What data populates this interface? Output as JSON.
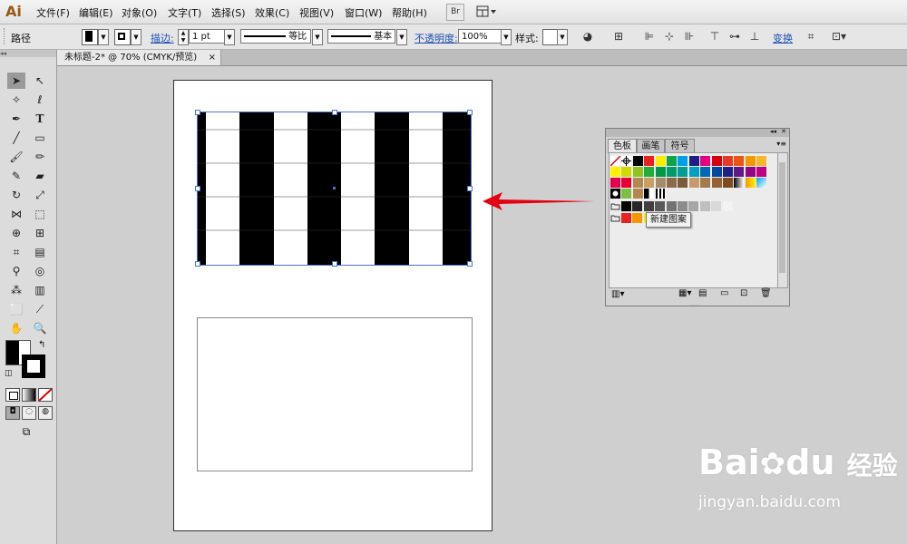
{
  "app": {
    "logo": "Ai"
  },
  "menu": [
    "文件(F)",
    "编辑(E)",
    "对象(O)",
    "文字(T)",
    "选择(S)",
    "效果(C)",
    "视图(V)",
    "窗口(W)",
    "帮助(H)"
  ],
  "menubar_buttons": {
    "bridge": "Br"
  },
  "control_bar": {
    "selection_label": "路径",
    "stroke_link": "描边:",
    "stroke_weight": "1 pt",
    "profile_label": "等比",
    "brush_label": "基本",
    "opacity_link": "不透明度:",
    "opacity_value": "100%",
    "style_label": "样式:",
    "transform_link": "变换"
  },
  "document": {
    "tab_title": "未标题-2* @ 70% (CMYK/预览)",
    "close_glyph": "×"
  },
  "panel": {
    "tabs": [
      "色板",
      "画笔",
      "符号"
    ],
    "tooltip": "新建图案",
    "collapse_glyph": "◂◂",
    "close_glyph": "✕",
    "menu_glyph": "▾≡"
  },
  "swatch_colors": {
    "row1": [
      "#ffffff",
      "#ffffff",
      "#000000",
      "#e8231f",
      "#ffeb00",
      "#0fa44a",
      "#00a0e9",
      "#1d2088",
      "#e4007f",
      "#d7000f",
      "#e73828",
      "#ea5514",
      "#f39800",
      "#f8b62d"
    ],
    "row2": [
      "#fff100",
      "#cfdb00",
      "#8fc31f",
      "#22ac38",
      "#009944",
      "#009b6b",
      "#009e96",
      "#00a0c1",
      "#0068b7",
      "#00479d",
      "#1d2088",
      "#601986",
      "#920783",
      "#be0081"
    ],
    "row3": [
      "#e5004f",
      "#e60033",
      "#b28850",
      "#c9a063",
      "#a68b6b",
      "#8b6b4b",
      "#7b5b3b",
      "#c49a6c",
      "#a57a4b",
      "#956134",
      "#7e4c1c",
      "#603813",
      "#4c2c0c",
      "#3a1f05"
    ],
    "grays": [
      "#000000",
      "#262626",
      "#404040",
      "#595959",
      "#737373",
      "#8c8c8c",
      "#a6a6a6",
      "#bfbfbf",
      "#d9d9d9",
      "#f2f2f2"
    ],
    "bright": [
      "#e8231f",
      "#f39800",
      "#fff100"
    ]
  },
  "watermark": {
    "brand": "Bai",
    "brand2": "du",
    "cn": "经验",
    "url": "jingyan.baidu.com"
  },
  "arrow_color": "#e60012",
  "accent_link_color": "#1d4fb0"
}
